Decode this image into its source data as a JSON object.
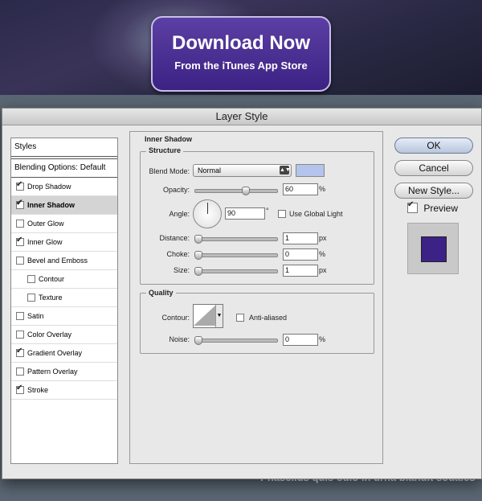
{
  "background": {
    "download_title": "Download Now",
    "download_sub": "From the iTunes App Store",
    "bullet_text": "Phasellus quis odio in urna blandit sodales"
  },
  "dialog": {
    "title": "Layer Style",
    "styles_list": {
      "header": "Styles",
      "blending": "Blending Options: Default",
      "items": [
        {
          "label": "Drop Shadow",
          "checked": true
        },
        {
          "label": "Inner Shadow",
          "checked": true,
          "selected": true
        },
        {
          "label": "Outer Glow",
          "checked": false
        },
        {
          "label": "Inner Glow",
          "checked": true
        },
        {
          "label": "Bevel and Emboss",
          "checked": false
        },
        {
          "label": "Contour",
          "checked": false,
          "indent": true
        },
        {
          "label": "Texture",
          "checked": false,
          "indent": true
        },
        {
          "label": "Satin",
          "checked": false
        },
        {
          "label": "Color Overlay",
          "checked": false
        },
        {
          "label": "Gradient Overlay",
          "checked": true
        },
        {
          "label": "Pattern Overlay",
          "checked": false
        },
        {
          "label": "Stroke",
          "checked": true
        }
      ]
    },
    "panel": {
      "section_title": "Inner Shadow",
      "structure": {
        "label": "Structure",
        "blend_mode_label": "Blend Mode:",
        "blend_mode_value": "Normal",
        "color": "#b5c4ec",
        "opacity_label": "Opacity:",
        "opacity_value": "60",
        "opacity_unit": "%",
        "angle_label": "Angle:",
        "angle_value": "90",
        "angle_unit": "°",
        "global_light_label": "Use Global Light",
        "distance_label": "Distance:",
        "distance_value": "1",
        "distance_unit": "px",
        "choke_label": "Choke:",
        "choke_value": "0",
        "choke_unit": "%",
        "size_label": "Size:",
        "size_value": "1",
        "size_unit": "px"
      },
      "quality": {
        "label": "Quality",
        "contour_label": "Contour:",
        "anti_aliased_label": "Anti-aliased",
        "noise_label": "Noise:",
        "noise_value": "0",
        "noise_unit": "%"
      }
    },
    "buttons": {
      "ok": "OK",
      "cancel": "Cancel",
      "new_style": "New Style...",
      "preview_label": "Preview"
    }
  }
}
